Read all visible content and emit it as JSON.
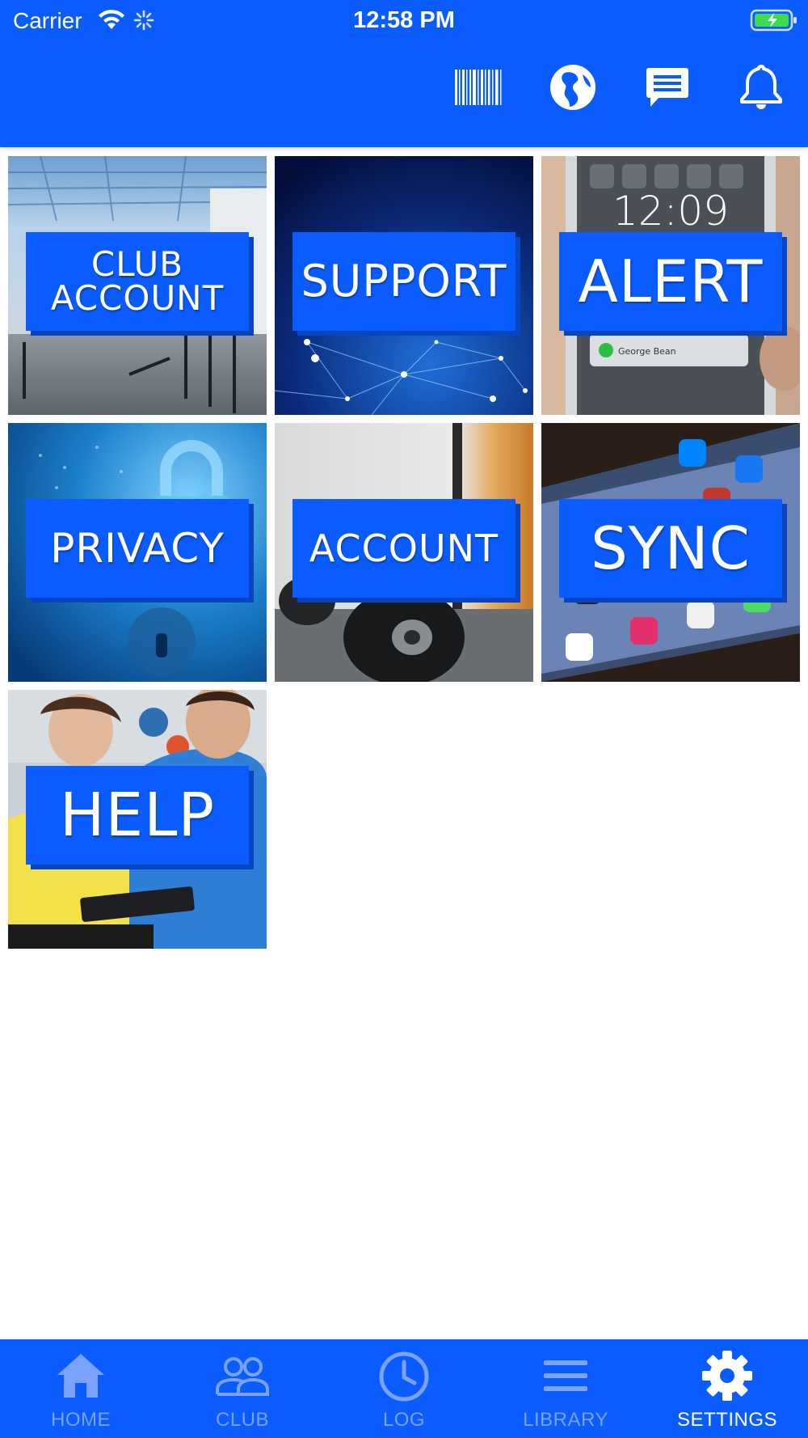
{
  "status_bar": {
    "carrier": "Carrier",
    "time": "12:58 PM"
  },
  "header": {
    "icons": [
      "barcode-icon",
      "globe-icon",
      "chat-icon",
      "bell-icon"
    ]
  },
  "tiles": [
    {
      "label_line1": "CLUB",
      "label_line2": "ACCOUNT",
      "image": "gym-floor"
    },
    {
      "label": "SUPPORT",
      "image": "network-lines"
    },
    {
      "label": "ALERT",
      "image": "phone-lockscreen"
    },
    {
      "label": "PRIVACY",
      "image": "padlock-digital"
    },
    {
      "label": "ACCOUNT",
      "image": "dumbbell"
    },
    {
      "label": "SYNC",
      "image": "phone-apps"
    },
    {
      "label": "HELP",
      "image": "trainer-clipboard"
    }
  ],
  "tabbar": {
    "tabs": [
      {
        "label": "HOME",
        "icon": "home-icon",
        "active": false
      },
      {
        "label": "CLUB",
        "icon": "people-icon",
        "active": false
      },
      {
        "label": "LOG",
        "icon": "clock-icon",
        "active": false
      },
      {
        "label": "LIBRARY",
        "icon": "menu-lines-icon",
        "active": false
      },
      {
        "label": "SETTINGS",
        "icon": "gear-icon",
        "active": true
      }
    ]
  },
  "colors": {
    "brand_blue": "#0a5cff",
    "inactive_tab": "#7aa2ff",
    "active_tab": "#ffffff"
  }
}
